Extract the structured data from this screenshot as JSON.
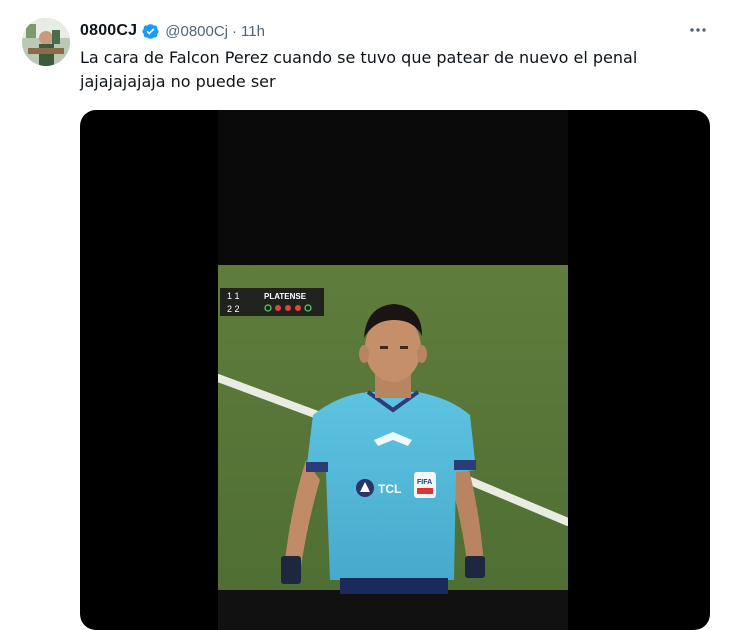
{
  "tweet": {
    "author_name": "0800CJ",
    "author_handle": "@0800Cj",
    "separator": "·",
    "time": "11h",
    "text": "La cara de Falcon Perez cuando se tuvo que patear de nuevo el penal jajajajajaja no puede ser",
    "verified_icon": "verified-badge-icon",
    "more_icon": "more-dots-icon"
  },
  "media": {
    "scoreboard": {
      "row1_scores": "1 1",
      "row2_scores": "2 2",
      "team": "PLATENSE"
    },
    "shirt_sponsor": "TCL",
    "shirt_badge": "FIFA"
  },
  "colors": {
    "verified_blue": "#1d9bf0",
    "text_primary": "#0f1419",
    "text_secondary": "#536471"
  }
}
